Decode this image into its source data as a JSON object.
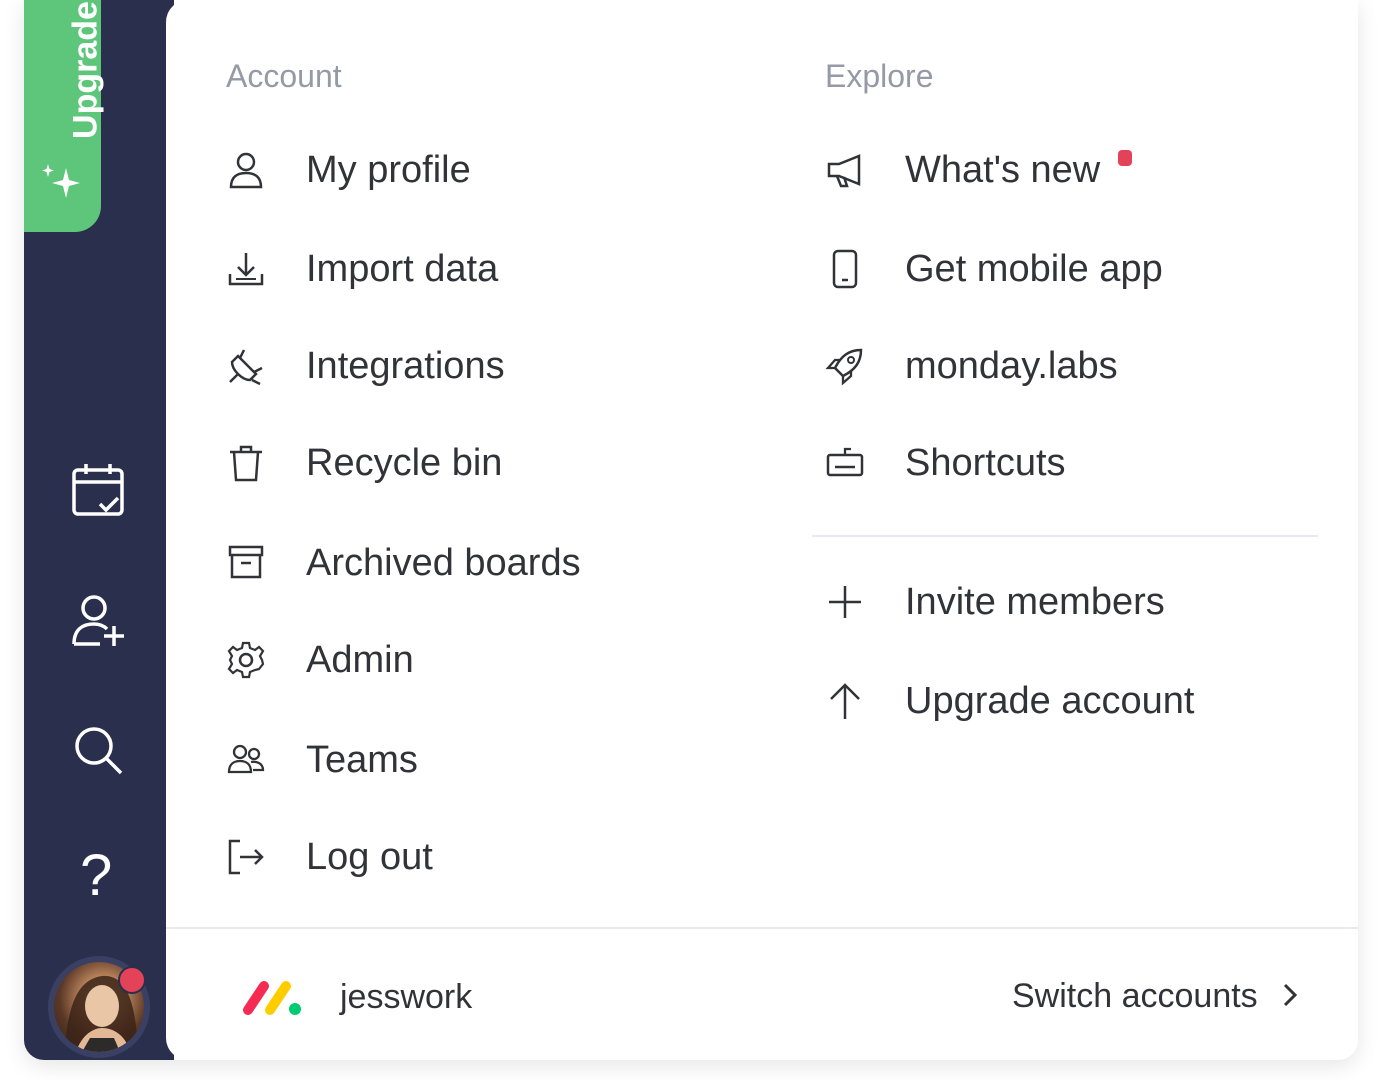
{
  "sidebar": {
    "upgrade_label": "Upgrade",
    "icons": [
      "my-work-icon",
      "invite-user-icon",
      "search-icon",
      "help-icon"
    ],
    "help_glyph": "?"
  },
  "account": {
    "title": "Account",
    "items": [
      {
        "label": "My profile",
        "icon": "user-icon"
      },
      {
        "label": "Import data",
        "icon": "download-icon"
      },
      {
        "label": "Integrations",
        "icon": "plug-icon"
      },
      {
        "label": "Recycle bin",
        "icon": "trash-icon"
      },
      {
        "label": "Archived boards",
        "icon": "archive-icon"
      },
      {
        "label": "Admin",
        "icon": "gear-icon"
      },
      {
        "label": "Teams",
        "icon": "teams-icon"
      },
      {
        "label": "Log out",
        "icon": "logout-icon"
      }
    ]
  },
  "explore": {
    "title": "Explore",
    "items": [
      {
        "label": "What's new",
        "icon": "megaphone-icon",
        "badge": true
      },
      {
        "label": "Get mobile app",
        "icon": "mobile-icon"
      },
      {
        "label": "monday.labs",
        "icon": "rocket-icon"
      },
      {
        "label": "Shortcuts",
        "icon": "keyboard-icon"
      }
    ],
    "actions": [
      {
        "label": "Invite members",
        "icon": "plus-icon"
      },
      {
        "label": "Upgrade account",
        "icon": "arrow-up-icon"
      }
    ]
  },
  "footer": {
    "account_name": "jesswork",
    "switch_label": "Switch accounts",
    "logo_colors": [
      "#f62b54",
      "#ffcc00",
      "#00ca72"
    ]
  },
  "colors": {
    "sidebar": "#292f4c",
    "upgrade": "#5dc67a",
    "notification": "#e44258"
  }
}
